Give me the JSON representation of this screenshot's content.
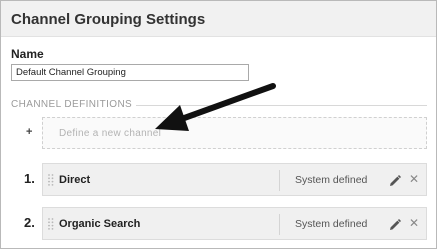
{
  "header": {
    "title": "Channel Grouping Settings"
  },
  "name_field": {
    "label": "Name",
    "value": "Default Channel Grouping"
  },
  "definitions": {
    "section_label": "CHANNEL DEFINITIONS",
    "add_symbol": "+",
    "new_channel_label": "Define a new channel"
  },
  "channels": [
    {
      "number": "1.",
      "name": "Direct",
      "status": "System defined"
    },
    {
      "number": "2.",
      "name": "Organic Search",
      "status": "System defined"
    }
  ],
  "icons": {
    "edit": "pencil-icon",
    "delete": "close-icon",
    "drag": "drag-handle-icon"
  },
  "colors": {
    "header_bg": "#f1f1f1",
    "row_bg": "#f0f0f0",
    "muted_text": "#9a9a9a",
    "arrow": "#111111"
  }
}
